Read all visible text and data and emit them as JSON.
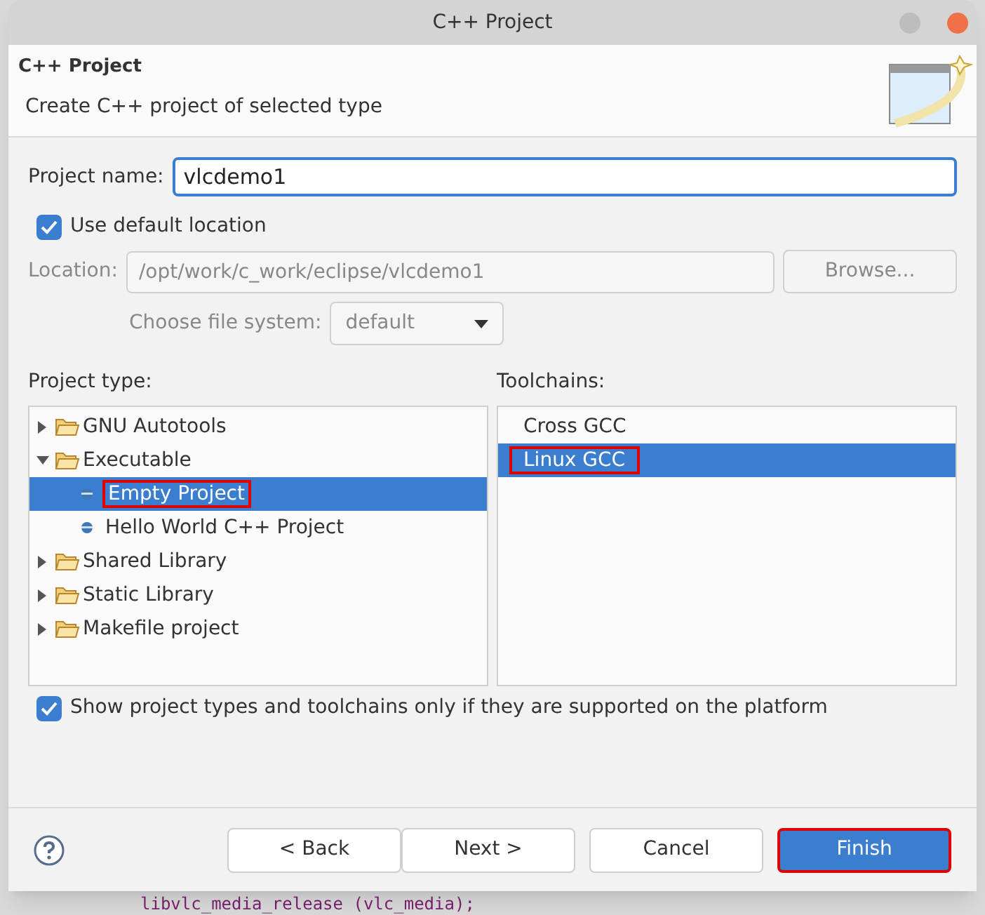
{
  "window": {
    "title": "C++ Project"
  },
  "header": {
    "title": "C++ Project",
    "description": "Create C++ project of selected type"
  },
  "project_name": {
    "label": "Project name:",
    "value": "vlcdemo1"
  },
  "use_default_location": {
    "label": "Use default location",
    "checked": true
  },
  "location": {
    "label": "Location:",
    "value": "/opt/work/c_work/eclipse/vlcdemo1",
    "disabled": true,
    "browse": "Browse..."
  },
  "file_system": {
    "label": "Choose file system:",
    "value": "default",
    "disabled": true
  },
  "project_type": {
    "label": "Project type:",
    "items": [
      {
        "label": "GNU Autotools",
        "expanded": false,
        "selected": false,
        "annotated": false
      },
      {
        "label": "Executable",
        "expanded": true,
        "selected": false,
        "annotated": false,
        "children": [
          {
            "label": "Empty Project",
            "selected": true,
            "annotated": true
          },
          {
            "label": "Hello World C++ Project",
            "selected": false,
            "annotated": false
          }
        ]
      },
      {
        "label": "Shared Library",
        "expanded": false,
        "selected": false,
        "annotated": false
      },
      {
        "label": "Static Library",
        "expanded": false,
        "selected": false,
        "annotated": false
      },
      {
        "label": "Makefile project",
        "expanded": false,
        "selected": false,
        "annotated": false
      }
    ]
  },
  "toolchains": {
    "label": "Toolchains:",
    "items": [
      {
        "label": "Cross GCC",
        "selected": false,
        "annotated": false
      },
      {
        "label": "Linux GCC",
        "selected": true,
        "annotated": true
      }
    ]
  },
  "show_supported": {
    "label": "Show project types and toolchains only if they are supported on the platform",
    "checked": true
  },
  "buttons": [
    {
      "label": "< Back",
      "primary": false,
      "annotated": false
    },
    {
      "label": "Next >",
      "primary": false,
      "annotated": false
    },
    {
      "label": "Cancel",
      "primary": false,
      "annotated": false
    },
    {
      "label": "Finish",
      "primary": true,
      "annotated": true
    }
  ],
  "background_code": "libvlc_media_release (vlc_media);"
}
